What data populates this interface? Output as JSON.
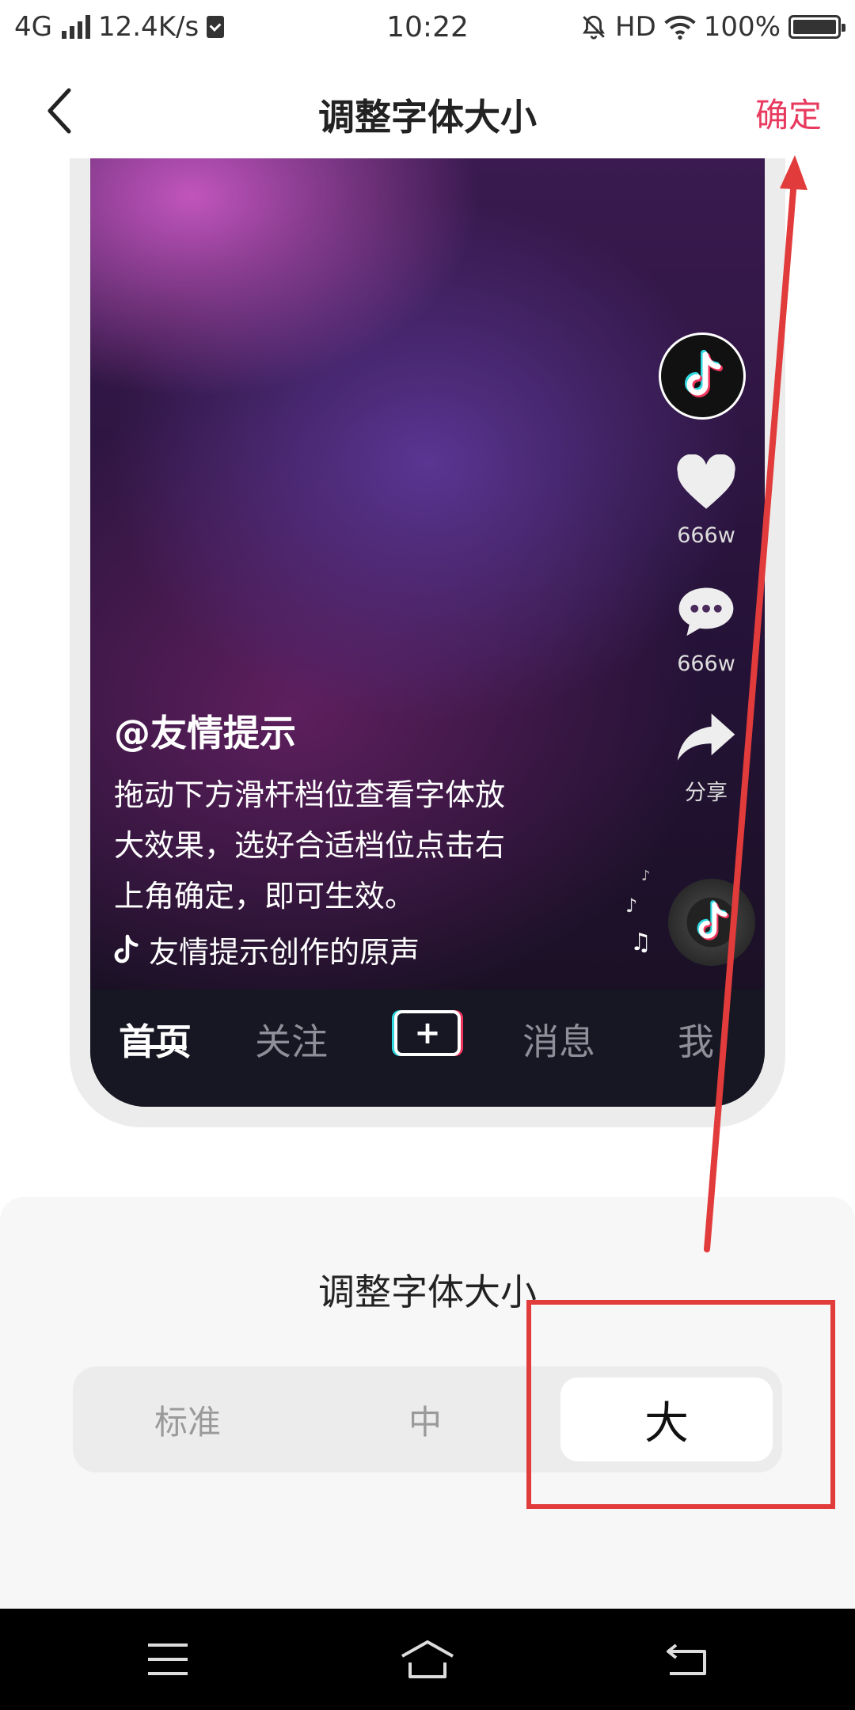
{
  "status_bar": {
    "network": "4G",
    "speed": "12.4K/s",
    "time": "10:22",
    "hd": "HD",
    "battery": "100%",
    "battery_level": 1.0
  },
  "header": {
    "title": "调整字体大小",
    "confirm_label": "确定"
  },
  "preview": {
    "actions": [
      {
        "icon": "heart-icon",
        "label": "666w"
      },
      {
        "icon": "comment-icon",
        "label": "666w"
      },
      {
        "icon": "share-icon",
        "label": "分享"
      }
    ],
    "username": "@友情提示",
    "description_lines": [
      "拖动下方滑杆档位查看字体放",
      "大效果，选好合适档位点击右",
      "上角确定，即可生效。"
    ],
    "sound": "友情提示创作的原声",
    "tabs": [
      "首页",
      "关注",
      "消息",
      "我"
    ],
    "plus_label": "+",
    "active_tab": "首页"
  },
  "font_panel": {
    "title": "调整字体大小",
    "options": [
      "标准",
      "中",
      "大"
    ],
    "selected": "大"
  },
  "colors": {
    "accent": "#e83a5f",
    "annotation": "#e23b3b",
    "tab_bar": "#161722"
  }
}
